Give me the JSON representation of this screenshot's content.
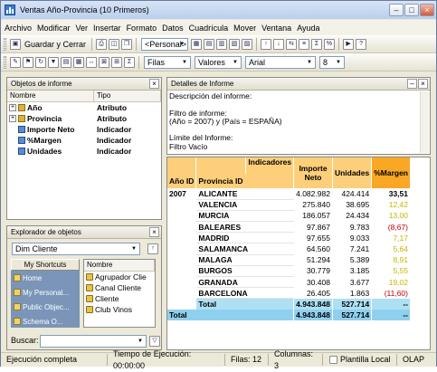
{
  "window": {
    "title": "Ventas Año-Provincia (10 Primeros)"
  },
  "menu": [
    "Archivo",
    "Modificar",
    "Ver",
    "Insertar",
    "Formato",
    "Datos",
    "Cuadrícula",
    "Mover",
    "Ventana",
    "Ayuda"
  ],
  "toolbar1": {
    "save_close": "Guardar y Cerrar",
    "view_combo": "<Personal>"
  },
  "toolbar2": {
    "filas": "Filas",
    "valores": "Valores",
    "font": "Arial",
    "size": "8"
  },
  "objects_panel": {
    "title": "Objetos de informe",
    "col_name": "Nombre",
    "col_type": "Tipo",
    "items": [
      {
        "name": "Año",
        "type": "Atributo",
        "kind": "attr",
        "expand": "+"
      },
      {
        "name": "Provincia",
        "type": "Atributo",
        "kind": "attr",
        "expand": "+"
      },
      {
        "name": "Importe Neto",
        "type": "Indicador",
        "kind": "ind",
        "expand": ""
      },
      {
        "name": "%Margen",
        "type": "Indicador",
        "kind": "ind",
        "expand": ""
      },
      {
        "name": "Unidades",
        "type": "Indicador",
        "kind": "ind",
        "expand": ""
      }
    ]
  },
  "explorer": {
    "title": "Explorador de objetos",
    "combo": "Dim Cliente",
    "shortcuts_title": "My Shortcuts",
    "shortcuts": [
      "Home",
      "My Personal...",
      "Public Objec...",
      "Schema O..."
    ],
    "list_header": "Nombre",
    "list": [
      "Agrupador Clie",
      "Canal Cliente",
      "Cliente",
      "Club Vinos"
    ],
    "search_label": "Buscar:"
  },
  "details": {
    "title": "Detalles de Informe",
    "lines": [
      "Descripción del informe:",
      "",
      "Filtro de informe:",
      "(Año = 2007) y (País = ESPAÑA)",
      "",
      "Límite del Informe:",
      "Filtro Vacío"
    ]
  },
  "grid": {
    "h_indicators": "Indicadores",
    "h_year": "Año ID",
    "h_prov": "Provincia ID",
    "h_importe": "Importe Neto",
    "h_unidades": "Unidades",
    "h_margen": "%Margen",
    "year": "2007",
    "rows": [
      {
        "p": "ALICANTE",
        "i": "4.082.982",
        "u": "424.414",
        "m": "33,51",
        "c": "#000000"
      },
      {
        "p": "VALENCIA",
        "i": "275.840",
        "u": "38.695",
        "m": "12,42",
        "c": "#c8b400"
      },
      {
        "p": "MURCIA",
        "i": "186.057",
        "u": "24.434",
        "m": "13,00",
        "c": "#c8b400"
      },
      {
        "p": "BALEARES",
        "i": "97.867",
        "u": "9.783",
        "m": "(8,67)",
        "c": "#c00000"
      },
      {
        "p": "MADRID",
        "i": "97.655",
        "u": "9.033",
        "m": "7,17",
        "c": "#c8b400"
      },
      {
        "p": "SALAMANCA",
        "i": "64.560",
        "u": "7.241",
        "m": "5,64",
        "c": "#c8b400"
      },
      {
        "p": "MALAGA",
        "i": "51.294",
        "u": "5.389",
        "m": "8,91",
        "c": "#c8b400"
      },
      {
        "p": "BURGOS",
        "i": "30.779",
        "u": "3.185",
        "m": "5,55",
        "c": "#c8b400"
      },
      {
        "p": "GRANADA",
        "i": "30.408",
        "u": "3.677",
        "m": "19,02",
        "c": "#c8b400"
      },
      {
        "p": "BARCELONA",
        "i": "26.405",
        "u": "1.863",
        "m": "(11,60)",
        "c": "#c00000"
      }
    ],
    "subtotal": {
      "label": "Total",
      "i": "4.943.848",
      "u": "527.714",
      "m": "--"
    },
    "total": {
      "label": "Total",
      "i": "4.943.848",
      "u": "527.714",
      "m": "--"
    }
  },
  "status": {
    "state": "Ejecución completa",
    "time": "Tiempo de Ejecución: 00:00:00",
    "rows": "Filas: 12",
    "cols": "Columnas: 3",
    "template": "Plantilla Local",
    "mode": "OLAP"
  }
}
